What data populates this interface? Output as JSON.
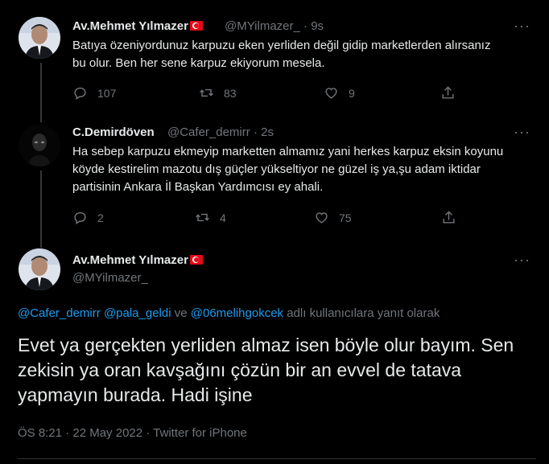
{
  "tweets": [
    {
      "name": "Av.Mehmet Yılmazer",
      "handle": "@MYilmazer_",
      "time": "· 9s",
      "text": "Batıya özeniyordunuz karpuzu eken yerliden değil gidip marketlerden alırsanız bu olur. Ben her sene karpuz ekiyorum mesela.",
      "replies": "107",
      "retweets": "83",
      "likes": "9"
    },
    {
      "name": "C.Demirdöven",
      "handle": "@Cafer_demirr",
      "time": "· 2s",
      "text": "Ha sebep karpuzu ekmeyip marketten almamız yani herkes karpuz eksin koyunu köyde kestirelim mazotu dış güçler yükseltiyor ne güzel iş ya,şu adam iktidar partisinin Ankara İl Başkan Yardımcısı ey ahali.",
      "replies": "2",
      "retweets": "4",
      "likes": "75"
    }
  ],
  "main_tweet": {
    "name": "Av.Mehmet Yılmazer",
    "handle": "@MYilmazer_",
    "reply_links": [
      "@Cafer_demirr",
      "@pala_geldi",
      "@06melihgokcek"
    ],
    "reply_sep": " ve ",
    "reply_sep_space": " ",
    "reply_suffix": " adlı kullanıcılara yanıt olarak",
    "text": "Evet ya gerçekten yerliden almaz isen böyle olur bayım. Sen zekisin ya oran kavşağını çözün bir an evvel de tatava yapmayın burada. Hadi işine",
    "meta": "ÖS 8:21 · 22 May 2022 · Twitter for iPhone"
  },
  "more_label": "···",
  "colors": {
    "background": "#000000",
    "text": "#e7e9ea",
    "muted": "#71767b",
    "link": "#1d9bf0"
  }
}
